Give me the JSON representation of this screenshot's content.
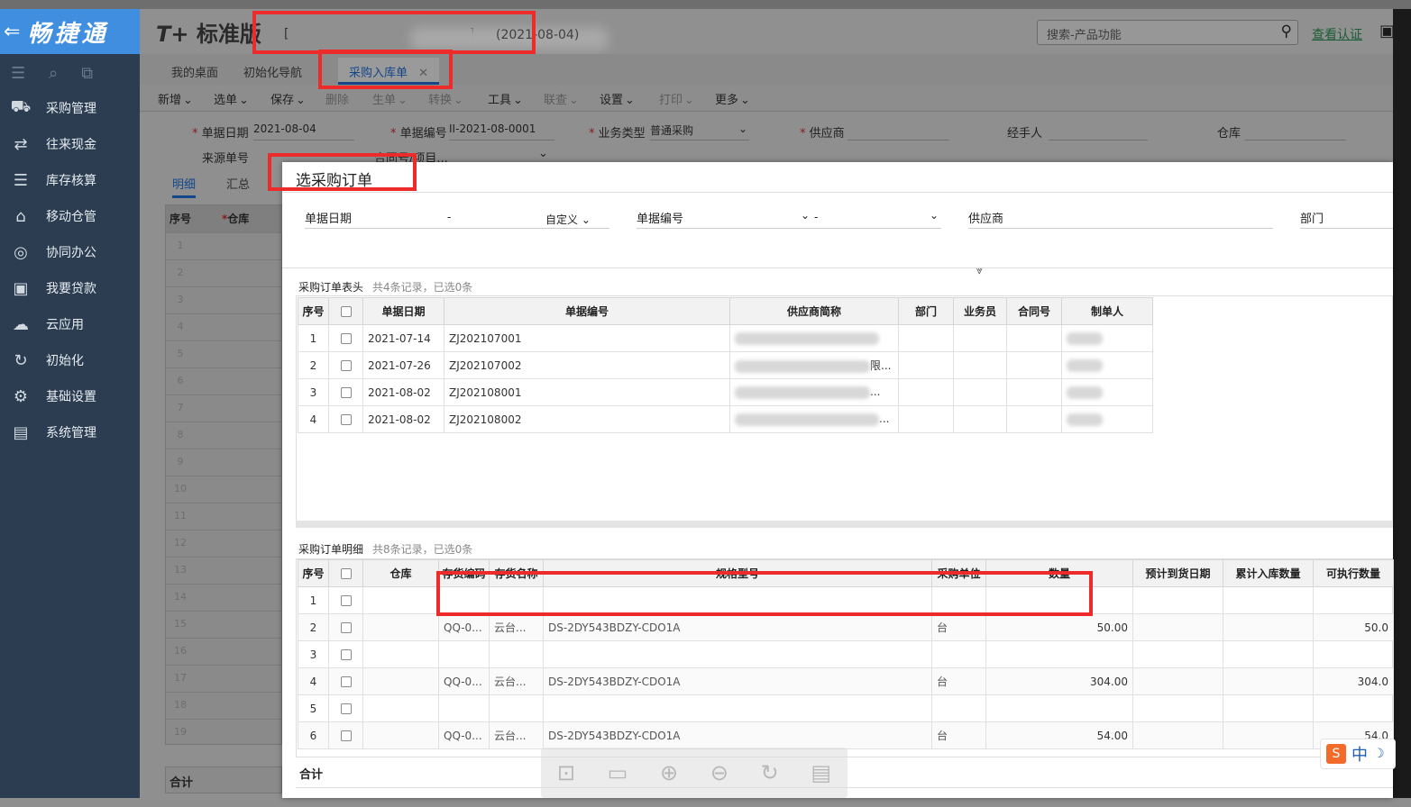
{
  "brand": {
    "name": "畅捷通",
    "back_icon": "back-arrow-icon"
  },
  "header": {
    "logo": "T+",
    "edition": "标准版",
    "account_prefix": "[",
    "account_suffix": "]",
    "date": "(2021-08-04)",
    "search_placeholder": "搜索-产品功能",
    "verify_link": "查看认证"
  },
  "sidebar": {
    "items": [
      {
        "label": "采购管理",
        "icon": "purchase-icon"
      },
      {
        "label": "往来现金",
        "icon": "exchange-icon"
      },
      {
        "label": "库存核算",
        "icon": "inventory-icon"
      },
      {
        "label": "移动仓管",
        "icon": "mobile-warehouse-icon"
      },
      {
        "label": "协同办公",
        "icon": "collaboration-icon"
      },
      {
        "label": "我要贷款",
        "icon": "loan-icon"
      },
      {
        "label": "云应用",
        "icon": "cloud-icon"
      },
      {
        "label": "初始化",
        "icon": "init-icon"
      },
      {
        "label": "基础设置",
        "icon": "settings-icon"
      },
      {
        "label": "系统管理",
        "icon": "system-icon"
      }
    ]
  },
  "tabs": {
    "home": "我的桌面",
    "init": "初始化导航",
    "active": "采购入库单",
    "close": "✕"
  },
  "toolbar": {
    "items": [
      "新增",
      "选单",
      "保存",
      "删除",
      "生单",
      "转换",
      "工具",
      "联查",
      "设置",
      "打印",
      "更多"
    ],
    "disabled": [
      "删除",
      "生单",
      "转换",
      "联查",
      "打印"
    ]
  },
  "form": {
    "doc_date_label": "单据日期",
    "doc_date": "2021-08-04",
    "doc_no_label": "单据编号",
    "doc_no": "II-2021-08-0001",
    "biz_type_label": "业务类型",
    "biz_type": "普通采购",
    "supplier_label": "供应商",
    "handler_label": "经手人",
    "warehouse_label": "仓库",
    "source_label": "来源单号",
    "contract_label": "合同号/项目...",
    "tab_detail": "明细",
    "tab_summary": "汇总",
    "col_no": "序号",
    "col_wh": "仓库",
    "row_numbers": [
      "1",
      "2",
      "3",
      "4",
      "5",
      "6",
      "7",
      "8",
      "9",
      "10",
      "11",
      "12",
      "13",
      "14",
      "15",
      "16",
      "17",
      "18",
      "19"
    ],
    "total": "合计"
  },
  "dialog": {
    "title": "选采购订单",
    "q_date": "单据日期",
    "q_dash": "-",
    "q_custom": "自定义",
    "q_docno": "单据编号",
    "q_supplier": "供应商",
    "q_dept": "部门",
    "header_section": "采购订单表头",
    "header_meta": "共4条记录，已选0条",
    "header_cols": [
      "序号",
      "",
      "单据日期",
      "单据编号",
      "供应商简称",
      "部门",
      "业务员",
      "合同号",
      "制单人"
    ],
    "header_rows": [
      {
        "no": "1",
        "date": "2021-07-14",
        "code": "ZJ202107001",
        "supplier_tail": ""
      },
      {
        "no": "2",
        "date": "2021-07-26",
        "code": "ZJ202107002",
        "supplier_tail": "限..."
      },
      {
        "no": "3",
        "date": "2021-08-02",
        "code": "ZJ202108001",
        "supplier_tail": "..."
      },
      {
        "no": "4",
        "date": "2021-08-02",
        "code": "ZJ202108002",
        "supplier_tail": "..."
      }
    ],
    "detail_section": "采购订单明细",
    "detail_meta": "共8条记录，已选0条",
    "detail_cols": [
      "序号",
      "",
      "仓库",
      "存货编码",
      "存货名称",
      "规格型号",
      "采购单位",
      "数量",
      "预计到货日期",
      "累计入库数量",
      "可执行数量"
    ],
    "detail_rows": [
      {
        "no": "1",
        "code": "",
        "name": "",
        "spec": "",
        "unit": "",
        "qty": "",
        "exec": ""
      },
      {
        "no": "2",
        "code": "QQ-0...",
        "name": "云台...",
        "spec": "DS-2DY543BDZY-CDO1A",
        "unit": "台",
        "qty": "50.00",
        "exec": "50.0"
      },
      {
        "no": "3",
        "code": "",
        "name": "",
        "spec": "",
        "unit": "",
        "qty": "",
        "exec": ""
      },
      {
        "no": "4",
        "code": "QQ-0...",
        "name": "云台...",
        "spec": "DS-2DY543BDZY-CDO1A",
        "unit": "台",
        "qty": "304.00",
        "exec": "304.0"
      },
      {
        "no": "5",
        "code": "",
        "name": "",
        "spec": "",
        "unit": "",
        "qty": "",
        "exec": ""
      },
      {
        "no": "6",
        "code": "QQ-0...",
        "name": "云台...",
        "spec": "DS-2DY543BDZY-CDO1A",
        "unit": "台",
        "qty": "54.00",
        "exec": "54.0"
      }
    ],
    "total": "合计"
  },
  "ime": {
    "lang": "中"
  },
  "colors": {
    "brand_blue": "#3f8ee0",
    "sidebar_bg": "#2c3d52",
    "highlight_red": "#ee2b2b",
    "active_tab": "#13478a"
  }
}
